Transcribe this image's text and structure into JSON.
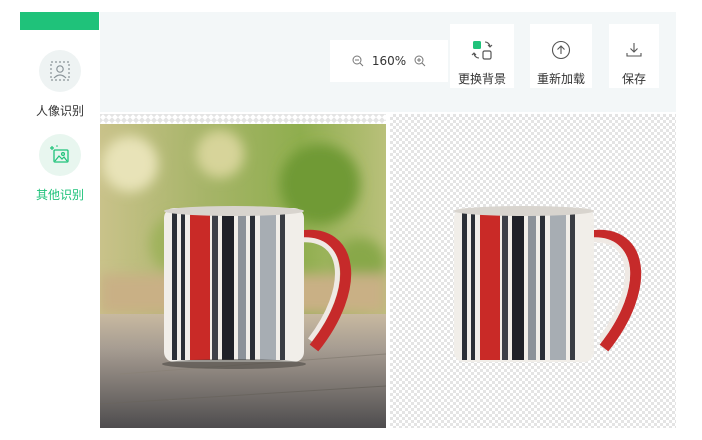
{
  "sidebar": {
    "items": [
      {
        "label": "人像识别",
        "icon": "portrait-frame-icon",
        "active": false
      },
      {
        "label": "其他识别",
        "icon": "image-sparkle-icon",
        "active": true
      }
    ],
    "accent": "#1fc27a"
  },
  "toolbar": {
    "zoom": "160%",
    "zoom_out_icon": "zoom-out-icon",
    "zoom_in_icon": "zoom-in-icon",
    "replace_bg_label": "更换背景",
    "reload_label": "重新加载",
    "save_label": "保存"
  },
  "canvas": {
    "original_image": "striped-mug-photo",
    "result_image": "striped-mug-cutout",
    "result_background": "transparent-checkerboard"
  }
}
